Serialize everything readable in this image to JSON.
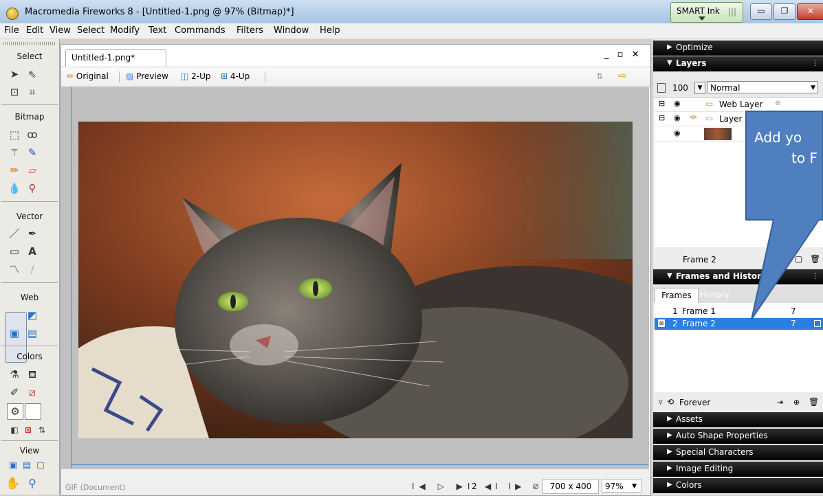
{
  "window": {
    "title": "Macromedia Fireworks 8 - [Untitled-1.png @ 97% (Bitmap)*]",
    "smart_ink_label": "SMART Ink",
    "min_glyph": "▭",
    "max_glyph": "❐",
    "close_glyph": "✕"
  },
  "menu": [
    "File",
    "Edit",
    "View",
    "Select",
    "Modify",
    "Text",
    "Commands",
    "Filters",
    "Window",
    "Help"
  ],
  "toolbox": {
    "sections": {
      "select": "Select",
      "bitmap": "Bitmap",
      "vector": "Vector",
      "web": "Web",
      "colors": "Colors",
      "view": "View"
    }
  },
  "document": {
    "tab_label": "Untitled-1.png*",
    "window_controls": "_ ▫ ✕",
    "view_options": {
      "original": "Original",
      "preview": "Preview",
      "two_up": "2-Up",
      "four_up": "4-Up"
    },
    "status_type": "GIF (Document)",
    "status_controls": "I◀ ▷ ▶I",
    "current_frame": "2",
    "canvas_size": "700 x 400",
    "zoom": "97%"
  },
  "panels": {
    "optimize": "Optimize",
    "layers": {
      "title": "Layers",
      "opacity": "100",
      "blend_mode": "Normal",
      "rows": [
        {
          "name": "Web Layer"
        },
        {
          "name": "Layer"
        }
      ],
      "footer_frame": "Frame 2"
    },
    "frames_history": {
      "title": "Frames and History",
      "tab_frames": "Frames",
      "tab_history": "History",
      "frames": [
        {
          "index": "1",
          "name": "Frame 1",
          "delay": "7"
        },
        {
          "index": "2",
          "name": "Frame 2",
          "delay": "7"
        }
      ],
      "loop_label": "Forever"
    },
    "collapsed": [
      "Assets",
      "Auto Shape Properties",
      "Special Characters",
      "Image Editing",
      "Colors"
    ]
  },
  "callout": {
    "line1": "Add yo",
    "line2": "to F"
  },
  "colors": {
    "accent": "#3b8fd6",
    "selection": "#2b7fe0",
    "callout": "#4f7fbe",
    "panel_header": "#000000"
  }
}
